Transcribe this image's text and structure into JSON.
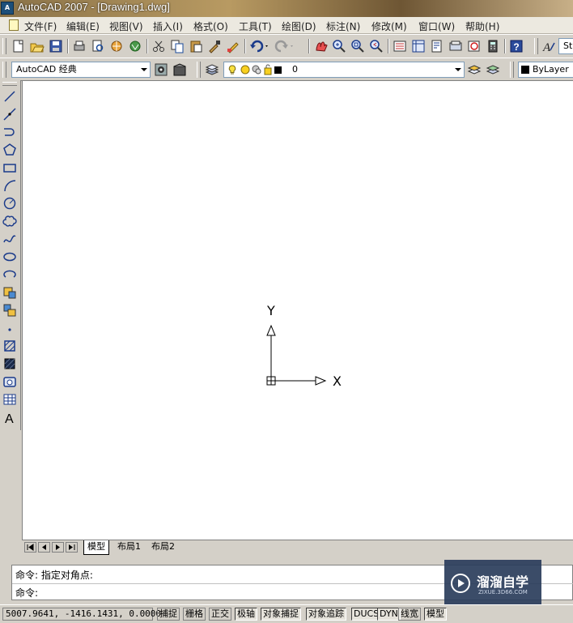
{
  "window": {
    "title": "AutoCAD 2007 - [Drawing1.dwg]"
  },
  "menu": [
    "文件(F)",
    "编辑(E)",
    "视图(V)",
    "插入(I)",
    "格式(O)",
    "工具(T)",
    "绘图(D)",
    "标注(N)",
    "修改(M)",
    "窗口(W)",
    "帮助(H)"
  ],
  "toolbar_standard": {
    "icons": [
      "new-icon",
      "open-icon",
      "save-icon",
      "plot-icon",
      "plot-preview-icon",
      "publish-icon",
      "3d-dwf-icon",
      "cut-icon",
      "copy-icon",
      "paste-icon",
      "match-properties-icon",
      "block-editor-icon",
      "undo-icon",
      "redo-icon",
      "pan-icon",
      "zoom-realtime-icon",
      "zoom-window-icon",
      "zoom-previous-icon",
      "properties-icon",
      "design-center-icon",
      "tool-palettes-icon",
      "sheet-set-icon",
      "markup-icon",
      "quickcalc-icon",
      "help-icon",
      "text-style-icon"
    ],
    "text_style_value": "St"
  },
  "toolbar_workspace": {
    "workspace_value": "AutoCAD 经典",
    "layer_value": "0",
    "color_value": "ByLayer"
  },
  "draw_toolbar": [
    "line-icon",
    "construction-line-icon",
    "polyline-icon",
    "polygon-icon",
    "rectangle-icon",
    "arc-icon",
    "circle-icon",
    "revision-cloud-icon",
    "spline-icon",
    "ellipse-icon",
    "ellipse-arc-icon",
    "insert-block-icon",
    "make-block-icon",
    "point-icon",
    "hatch-icon",
    "gradient-icon",
    "region-icon",
    "table-icon",
    "multiline-text-icon"
  ],
  "ucs": {
    "x_label": "X",
    "y_label": "Y"
  },
  "layout_tabs": [
    "模型",
    "布局1",
    "布局2"
  ],
  "command": {
    "history": "命令: 指定对角点:",
    "prompt": "命令:"
  },
  "watermark": {
    "title": "溜溜自学",
    "url": "ZIXUE.3D66.COM"
  },
  "status": {
    "coordinates": "5007.9641,  -1416.1431, 0.0000",
    "toggles": [
      {
        "label": "捕捉",
        "on": false
      },
      {
        "label": "栅格",
        "on": false
      },
      {
        "label": "正交",
        "on": false
      },
      {
        "label": "极轴",
        "on": true
      },
      {
        "label": "对象捕捉",
        "on": true
      },
      {
        "label": "对象追踪",
        "on": true
      },
      {
        "label": "DUCS",
        "on": true
      },
      {
        "label": "DYN",
        "on": true
      },
      {
        "label": "线宽",
        "on": false
      },
      {
        "label": "模型",
        "on": true
      }
    ]
  }
}
